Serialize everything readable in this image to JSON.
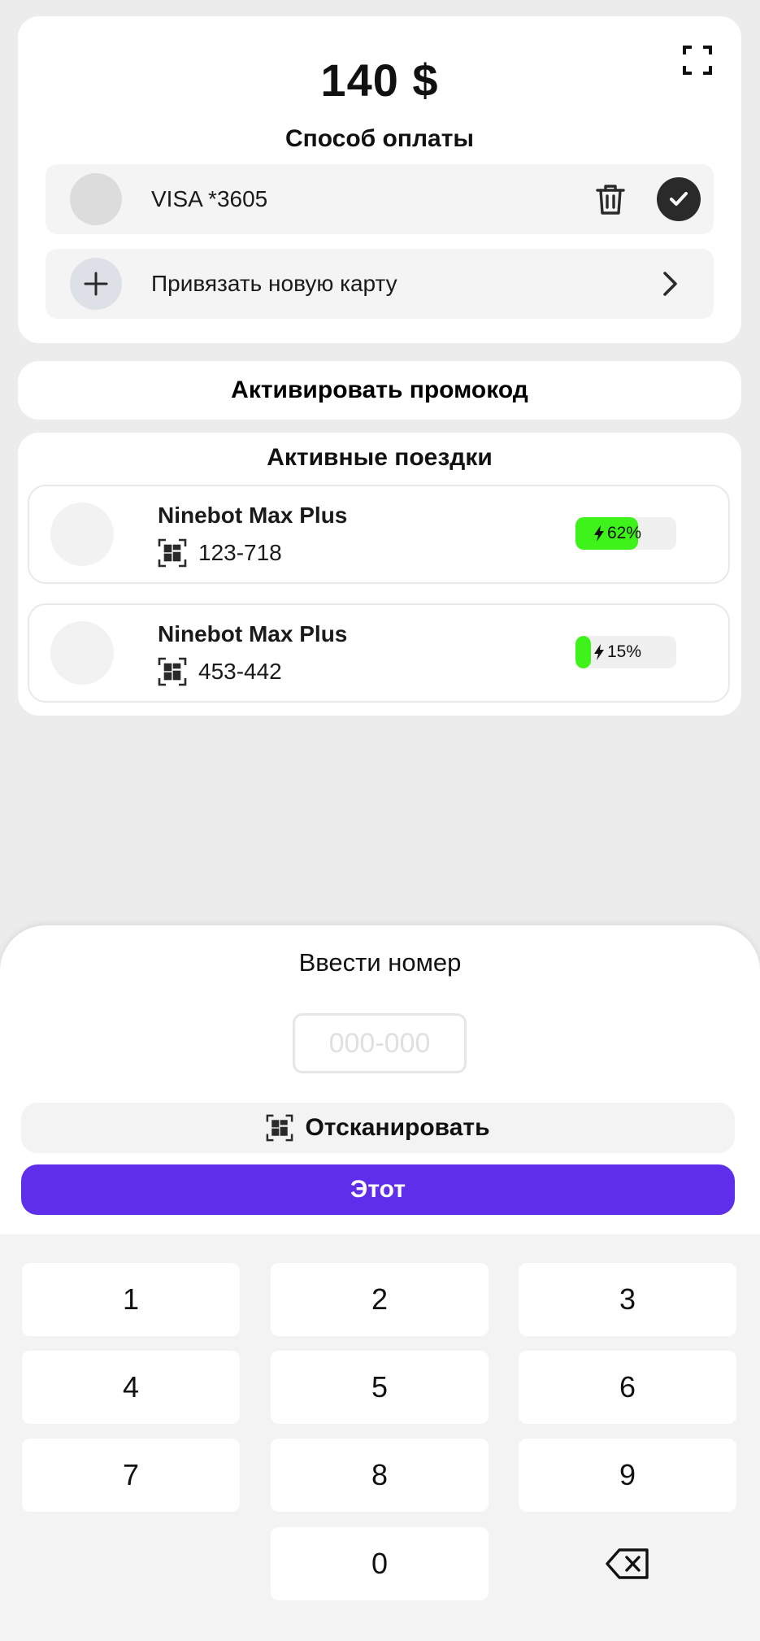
{
  "payment": {
    "amount": "140 $",
    "method_title": "Способ оплаты",
    "card_label": "VISA *3605",
    "add_card_label": "Привязать новую карту"
  },
  "promo": {
    "label": "Активировать промокод"
  },
  "rides": {
    "title": "Активные поездки",
    "items": [
      {
        "name": "Ninebot Max Plus",
        "number": "123-718",
        "battery": "62%",
        "battery_level": 0.62
      },
      {
        "name": "Ninebot Max Plus",
        "number": "453-442",
        "battery": "15%",
        "battery_level": 0.15
      }
    ]
  },
  "sheet": {
    "title": "Ввести номер",
    "input_placeholder": "000-000",
    "input_value": "",
    "scan_label": "Отсканировать",
    "confirm_label": "Этот"
  },
  "keypad": {
    "keys": [
      "1",
      "2",
      "3",
      "4",
      "5",
      "6",
      "7",
      "8",
      "9",
      "0"
    ]
  },
  "colors": {
    "accent": "#5f2eea",
    "battery_fill": "#3ef31a",
    "check_bg": "#2a2a2a"
  }
}
